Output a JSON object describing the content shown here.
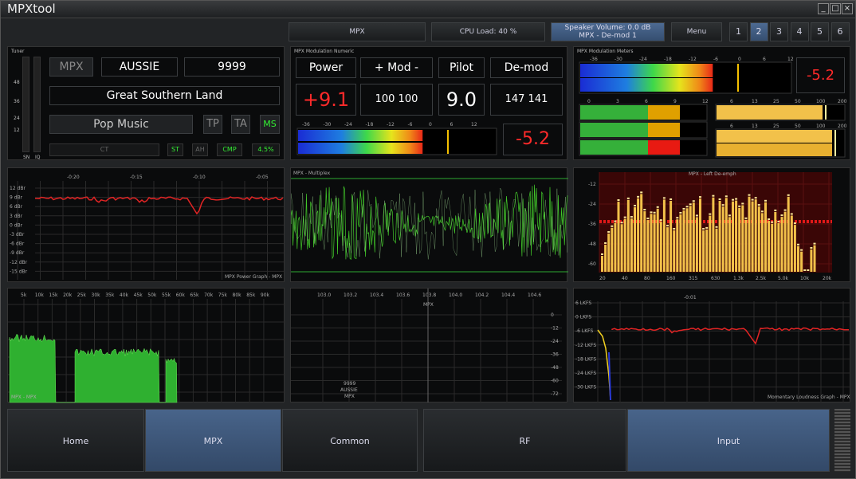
{
  "window": {
    "title": "MPXtool"
  },
  "toolbar": {
    "mpx": "MPX",
    "cpu_load": "CPU Load: 40 %",
    "speaker_line1": "Speaker Volume: 0.0 dB",
    "speaker_line2": "MPX - De-mod 1",
    "menu": "Menu",
    "pages": [
      "1",
      "2",
      "3",
      "4",
      "5",
      "6"
    ],
    "active_page": "2"
  },
  "tuner": {
    "label": "Tuner",
    "scale": [
      "48",
      "36",
      "24",
      "12"
    ],
    "sn_label": "SN",
    "iq_label": "IQ",
    "mode": "MPX",
    "ps_name": "AUSSIE",
    "pi_code": "9999",
    "radiotext": "Great Southern Land",
    "pty": "Pop Music",
    "tp": "TP",
    "ta": "TA",
    "ms": "MS",
    "ct": "CT",
    "st": "ST",
    "ah": "AH",
    "cmp": "CMP",
    "percent": "4.5%"
  },
  "numeric": {
    "label": "MPX Modulation Numeric",
    "power_label": "Power",
    "mod_label": "+ Mod -",
    "pilot_label": "Pilot",
    "demod_label": "De-mod",
    "power_value": "+9.1",
    "mod_value": "100 100",
    "pilot_value": "9.0",
    "demod_value": "147 141",
    "meter_ticks": [
      "-36",
      "-30",
      "-24",
      "-18",
      "-12",
      "-6",
      "0",
      "6",
      "12"
    ],
    "meter_level": 0.63,
    "peak_value": "-5.2"
  },
  "meters": {
    "label": "MPX Modulation Meters",
    "top_ticks": [
      "-36",
      "-30",
      "-24",
      "-18",
      "-12",
      "-6",
      "0",
      "6",
      "12"
    ],
    "top_level": 0.63,
    "peak_value": "-5.2",
    "left_ticks": [
      "0",
      "3",
      "6",
      "9",
      "12"
    ],
    "right_ticks": [
      "6",
      "13",
      "25",
      "50",
      "100",
      "200"
    ],
    "right_ticks2": [
      "6",
      "13",
      "25",
      "50",
      "100",
      "200"
    ]
  },
  "power_graph": {
    "time_ticks": [
      "-0:20",
      "-0:15",
      "-0:10",
      "-0:05"
    ],
    "db_ticks": [
      "12 dBr",
      "9 dBr",
      "6 dBr",
      "3 dBr",
      "0 dBr",
      "-3 dBr",
      "-6 dBr",
      "-9 dBr",
      "-12 dBr",
      "-15 dBr"
    ],
    "caption": "MPX Power Graph - MPX"
  },
  "multiplex": {
    "caption": "MPX - Multiplex"
  },
  "spectrum_demph": {
    "title": "MPX - Left De-emph",
    "db_ticks": [
      "-12",
      "-24",
      "-36",
      "-48",
      "-60"
    ],
    "freq_ticks": [
      "20",
      "40",
      "80",
      "160",
      "315",
      "630",
      "1.3k",
      "2.5k",
      "5.0k",
      "10k",
      "20k"
    ]
  },
  "mpx_spectrum": {
    "freq_ticks": [
      "5k",
      "10k",
      "15k",
      "20k",
      "25k",
      "30k",
      "35k",
      "40k",
      "45k",
      "50k",
      "55k",
      "60k",
      "65k",
      "70k",
      "75k",
      "80k",
      "85k",
      "90k"
    ],
    "caption": "MPX - MPX"
  },
  "band_scan": {
    "freq_ticks": [
      "103.0",
      "103.2",
      "103.4",
      "103.6",
      "103.8",
      "104.0",
      "104.2",
      "104.4",
      "104.6"
    ],
    "db_ticks": [
      "0",
      "-12",
      "-24",
      "-36",
      "-48",
      "-60",
      "-72"
    ],
    "right_ticks": [
      "-12",
      "-24",
      "-36",
      "-48",
      "-60",
      "-72"
    ],
    "marker_label": "MPX",
    "station_pi": "9999",
    "station_ps": "AUSSIE",
    "station_src": "MPX"
  },
  "loudness": {
    "time_tick": "-0:01",
    "ticks": [
      "6 LKFS",
      "0 LKFS",
      "-6 LKFS",
      "-12 LKFS",
      "-18 LKFS",
      "-24 LKFS",
      "-30 LKFS"
    ],
    "caption": "Momentary Loudness Graph - MPX"
  },
  "nav": {
    "home": "Home",
    "mpx": "MPX",
    "common": "Common",
    "rf": "RF",
    "input": "Input"
  },
  "colors": {
    "accent": "#4d6a92",
    "red_value": "#ff2a2a",
    "green_trace": "#36d11e",
    "yellow_bar": "#f2c14a"
  }
}
